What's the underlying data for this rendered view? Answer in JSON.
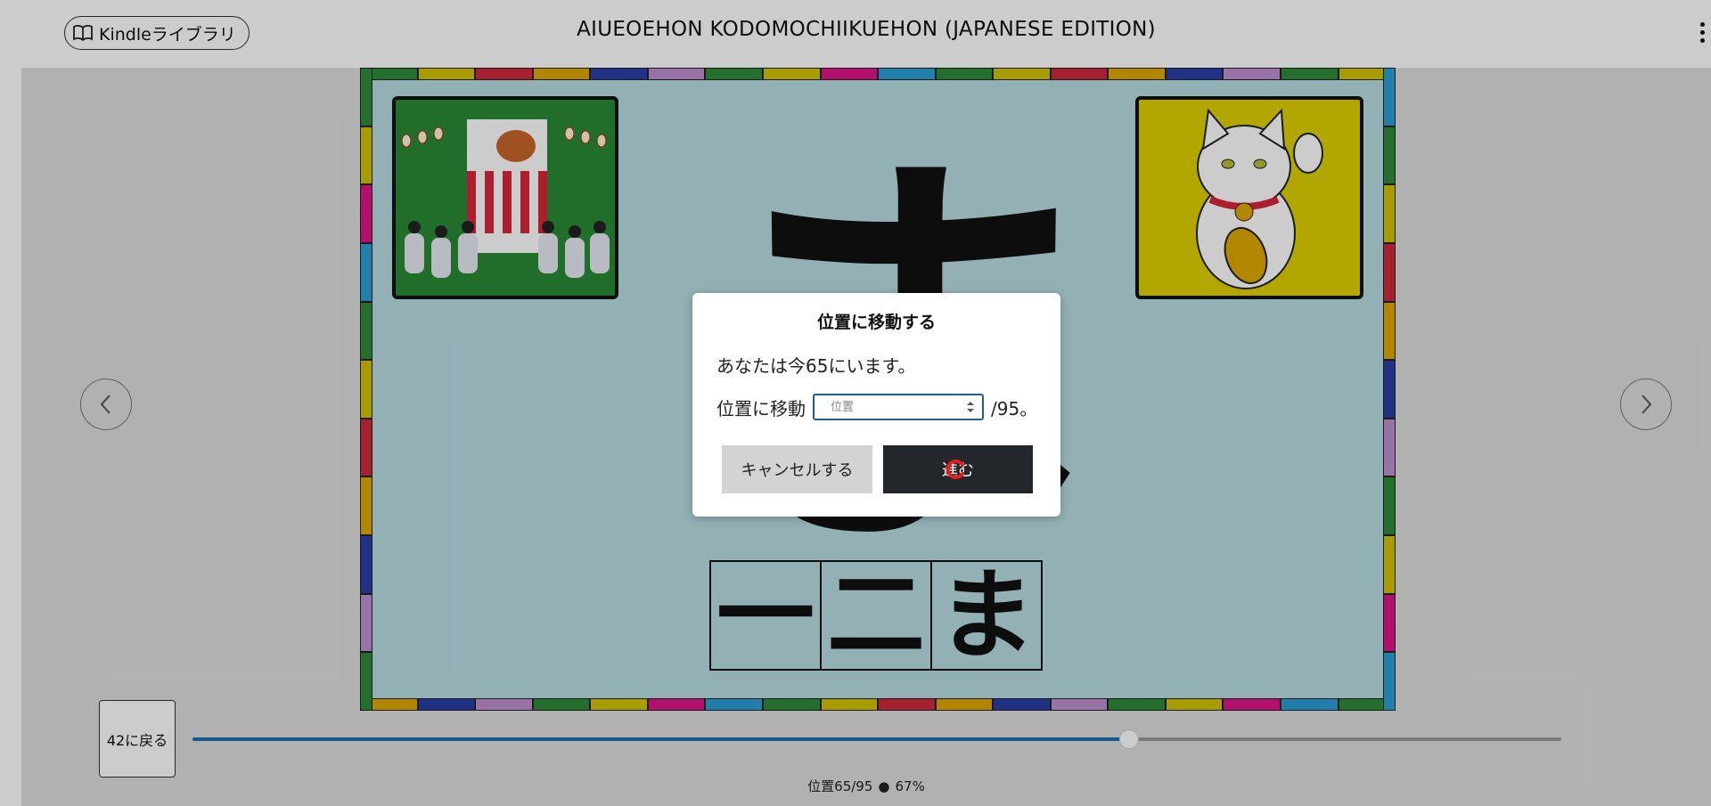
{
  "header": {
    "library_label": "Kindleライブラリ",
    "book_title": "AIUEOEHON KODOMOCHIIKUEHON (JAPANESE EDITION)"
  },
  "page": {
    "big_char": "ま",
    "stroke_boxes": [
      "一",
      "二",
      "ま"
    ],
    "images": [
      "festival-illustration",
      "maneki-neko-illustration"
    ],
    "border_colors": [
      "#2e8b3a",
      "#d4c400",
      "#d02a3c",
      "#e0a800",
      "#2a3fa8",
      "#c08fd2",
      "#2e8b3a",
      "#d4c400",
      "#e0148a",
      "#2aa0d6"
    ]
  },
  "dialog": {
    "title": "位置に移動する",
    "current_text": "あなたは今65にいます。",
    "goto_label": "位置に移動",
    "input_placeholder": "位置",
    "input_value": "",
    "total_suffix": "/95。",
    "cancel_label": "キャンセルする",
    "go_label": "進む"
  },
  "footer": {
    "back_label": "42に戻る",
    "location_text": "位置65/95",
    "percent_text": "67%",
    "progress_fraction": 0.684
  },
  "icons": {
    "library": "book-icon",
    "menu": "kebab-menu-icon",
    "prev": "chevron-left-icon",
    "next": "chevron-right-icon",
    "spinner": "number-spinner-icon",
    "cursor": "mouse-cursor-icon"
  },
  "colors": {
    "primary_button": "#23262b",
    "cancel_button": "#d3d3d3",
    "slider_fill": "#1f6fb7",
    "input_border": "#1f5f8b",
    "page_background": "#b8dde3"
  }
}
